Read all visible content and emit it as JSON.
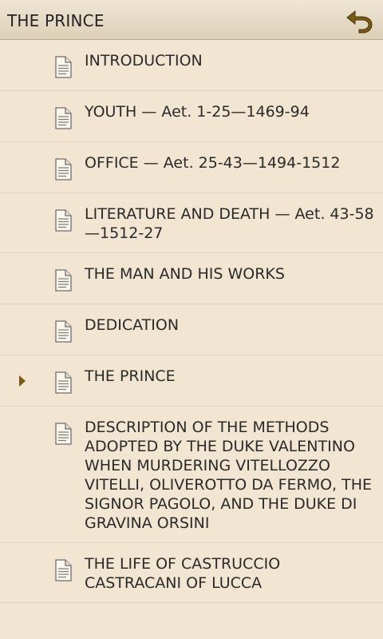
{
  "header": {
    "title": "THE PRINCE",
    "back_icon": "back-arrow-icon"
  },
  "toc": {
    "current_index": 6,
    "items": [
      {
        "label": "INTRODUCTION"
      },
      {
        "label": "YOUTH — Aet. 1-25—1469-94"
      },
      {
        "label": "OFFICE — Aet. 25-43—1494-1512"
      },
      {
        "label": "LITERATURE AND DEATH — Aet. 43-58—1512-27"
      },
      {
        "label": "THE MAN AND HIS WORKS"
      },
      {
        "label": "DEDICATION"
      },
      {
        "label": "THE PRINCE"
      },
      {
        "label": "DESCRIPTION OF THE METHODS ADOPTED BY THE DUKE VALENTINO WHEN MURDERING VITELLOZZO VITELLI, OLIVEROTTO DA FERMO, THE SIGNOR PAGOLO, AND THE DUKE DI GRAVINA ORSINI"
      },
      {
        "label": "THE LIFE OF CASTRUCCIO CASTRACANI OF LUCCA"
      }
    ]
  },
  "colors": {
    "background": "#f2e6d2",
    "accent": "#7a5a12",
    "text": "#2a2a2a"
  }
}
